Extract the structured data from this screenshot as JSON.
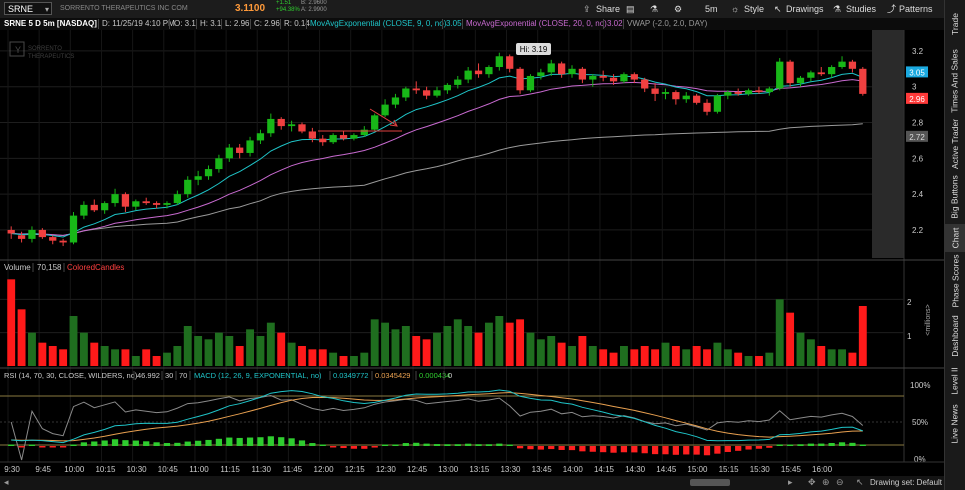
{
  "toolbar": {
    "symbol": "SRNE",
    "company": "SORRENTO THERAPEUTICS INC COM",
    "price": "3.1100",
    "change_abs": "+1.51",
    "change_pct": "+94.38%",
    "bid": "B: 2.9600",
    "ask": "A: 2.9900",
    "share": "Share",
    "timeframe": "5m",
    "style": "Style",
    "drawings": "Drawings",
    "studies": "Studies",
    "patterns": "Patterns"
  },
  "title_row": {
    "label": "SRNE 5 D 5m [NASDAQ]",
    "date": "D: 11/25/19 4:10 PM",
    "open": "O: 3.1",
    "high": "H: 3.1",
    "low": "L: 2.96",
    "close": "C: 2.96",
    "range": "R: 0.14",
    "ema9": "MovAvgExponential (CLOSE, 9, 0, no)",
    "ema9_val": "3.05",
    "ema20": "MovAvgExponential (CLOSE, 20, 0, no)",
    "ema20_val": "3.02",
    "vwap": "VWAP (-2.0, 2.0, DAY)"
  },
  "watermark": [
    "SORRENTO",
    "THERAPEUTICS"
  ],
  "price_axis": {
    "ticks": [
      "3.2",
      "3",
      "2.8",
      "2.6",
      "2.4",
      "2.2"
    ],
    "labels": [
      {
        "text": "3.05",
        "color": "#1aa9e0"
      },
      {
        "text": "2.96",
        "color": "#ff3a3a"
      },
      {
        "text": "2.72",
        "color": "#555555"
      }
    ]
  },
  "hi_label": "Hi: 3.19",
  "volume_pane": {
    "label": "Volume",
    "value": "70,158",
    "study": "ColoredCandles",
    "ticks": [
      "2",
      "1"
    ],
    "unit": "<millions>"
  },
  "indicator_pane": {
    "rsi": "RSI (14, 70, 30, CLOSE, WILDERS, no)",
    "rsi_val": "46.992",
    "ob": "30",
    "os": "70",
    "macd": "MACD (12, 26, 9, EXPONENTIAL, no)",
    "macd_val": "0.0349772",
    "signal_val": "0.0345429",
    "hist_val": "0.000434",
    "zero": "0",
    "ticks": [
      "100%",
      "50%",
      "0%"
    ]
  },
  "time_axis": [
    "9:30",
    "9:45",
    "10:00",
    "10:15",
    "10:30",
    "10:45",
    "11:00",
    "11:15",
    "11:30",
    "11:45",
    "12:00",
    "12:15",
    "12:30",
    "12:45",
    "13:00",
    "13:15",
    "13:30",
    "13:45",
    "14:00",
    "14:15",
    "14:30",
    "14:45",
    "15:00",
    "15:15",
    "15:30",
    "15:45",
    "16:00"
  ],
  "drawing_set": "Drawing set: Default",
  "right_rail": [
    "Trade",
    "Times And Sales",
    "Active Trader",
    "Big Buttons",
    "Chart",
    "Phase Scores",
    "Dashboard",
    "Level II",
    "Live News"
  ],
  "colors": {
    "up": "#18b718",
    "down": "#f04040",
    "ema9": "#1fc4c8",
    "ema20": "#c86ad0",
    "vwap": "#9a9a9a"
  },
  "chart_data": {
    "type": "candlestick",
    "price_range": [
      2.06,
      3.3
    ],
    "candles": [
      [
        2.2,
        2.22,
        2.15,
        2.18
      ],
      [
        2.17,
        2.19,
        2.13,
        2.15
      ],
      [
        2.15,
        2.22,
        2.13,
        2.2
      ],
      [
        2.2,
        2.21,
        2.15,
        2.16
      ],
      [
        2.16,
        2.17,
        2.12,
        2.14
      ],
      [
        2.14,
        2.15,
        2.11,
        2.13
      ],
      [
        2.13,
        2.3,
        2.12,
        2.28
      ],
      [
        2.28,
        2.36,
        2.26,
        2.34
      ],
      [
        2.34,
        2.37,
        2.3,
        2.31
      ],
      [
        2.31,
        2.36,
        2.29,
        2.35
      ],
      [
        2.35,
        2.43,
        2.33,
        2.4
      ],
      [
        2.4,
        2.41,
        2.3,
        2.33
      ],
      [
        2.33,
        2.37,
        2.31,
        2.36
      ],
      [
        2.36,
        2.38,
        2.34,
        2.35
      ],
      [
        2.35,
        2.36,
        2.32,
        2.34
      ],
      [
        2.34,
        2.36,
        2.32,
        2.35
      ],
      [
        2.35,
        2.42,
        2.34,
        2.4
      ],
      [
        2.4,
        2.5,
        2.38,
        2.48
      ],
      [
        2.48,
        2.53,
        2.45,
        2.5
      ],
      [
        2.5,
        2.56,
        2.48,
        2.54
      ],
      [
        2.54,
        2.62,
        2.52,
        2.6
      ],
      [
        2.6,
        2.68,
        2.58,
        2.66
      ],
      [
        2.66,
        2.68,
        2.6,
        2.63
      ],
      [
        2.63,
        2.72,
        2.61,
        2.7
      ],
      [
        2.7,
        2.76,
        2.68,
        2.74
      ],
      [
        2.74,
        2.85,
        2.72,
        2.82
      ],
      [
        2.82,
        2.83,
        2.76,
        2.78
      ],
      [
        2.78,
        2.81,
        2.75,
        2.79
      ],
      [
        2.79,
        2.8,
        2.74,
        2.75
      ],
      [
        2.75,
        2.77,
        2.69,
        2.71
      ],
      [
        2.71,
        2.73,
        2.67,
        2.69
      ],
      [
        2.69,
        2.74,
        2.68,
        2.73
      ],
      [
        2.73,
        2.75,
        2.7,
        2.71
      ],
      [
        2.71,
        2.74,
        2.7,
        2.73
      ],
      [
        2.73,
        2.78,
        2.72,
        2.76
      ],
      [
        2.76,
        2.85,
        2.75,
        2.84
      ],
      [
        2.84,
        2.93,
        2.83,
        2.9
      ],
      [
        2.9,
        2.96,
        2.88,
        2.94
      ],
      [
        2.94,
        3.0,
        2.92,
        2.99
      ],
      [
        2.99,
        3.03,
        2.96,
        2.98
      ],
      [
        2.98,
        3.0,
        2.93,
        2.95
      ],
      [
        2.95,
        3.0,
        2.94,
        2.98
      ],
      [
        2.98,
        3.02,
        2.96,
        3.01
      ],
      [
        3.01,
        3.06,
        2.99,
        3.04
      ],
      [
        3.04,
        3.11,
        3.02,
        3.09
      ],
      [
        3.09,
        3.13,
        3.05,
        3.07
      ],
      [
        3.07,
        3.12,
        3.05,
        3.11
      ],
      [
        3.11,
        3.19,
        3.09,
        3.17
      ],
      [
        3.17,
        3.18,
        3.08,
        3.1
      ],
      [
        3.1,
        3.11,
        2.96,
        2.98
      ],
      [
        2.98,
        3.07,
        2.97,
        3.06
      ],
      [
        3.06,
        3.1,
        3.04,
        3.08
      ],
      [
        3.08,
        3.15,
        3.06,
        3.13
      ],
      [
        3.13,
        3.14,
        3.05,
        3.07
      ],
      [
        3.07,
        3.12,
        3.05,
        3.1
      ],
      [
        3.1,
        3.11,
        3.02,
        3.04
      ],
      [
        3.04,
        3.07,
        3.0,
        3.06
      ],
      [
        3.06,
        3.09,
        3.03,
        3.05
      ],
      [
        3.05,
        3.07,
        3.01,
        3.03
      ],
      [
        3.03,
        3.08,
        3.02,
        3.07
      ],
      [
        3.07,
        3.08,
        3.02,
        3.04
      ],
      [
        3.04,
        3.05,
        2.97,
        2.99
      ],
      [
        2.99,
        3.02,
        2.92,
        2.96
      ],
      [
        2.96,
        2.99,
        2.93,
        2.97
      ],
      [
        2.97,
        2.98,
        2.9,
        2.93
      ],
      [
        2.93,
        2.97,
        2.91,
        2.95
      ],
      [
        2.95,
        2.96,
        2.9,
        2.91
      ],
      [
        2.91,
        2.93,
        2.84,
        2.86
      ],
      [
        2.86,
        2.96,
        2.85,
        2.95
      ],
      [
        2.95,
        2.98,
        2.93,
        2.97
      ],
      [
        2.97,
        2.99,
        2.95,
        2.96
      ],
      [
        2.96,
        2.99,
        2.95,
        2.98
      ],
      [
        2.98,
        3.0,
        2.96,
        2.97
      ],
      [
        2.97,
        3.0,
        2.95,
        2.99
      ],
      [
        2.99,
        3.16,
        2.98,
        3.14
      ],
      [
        3.14,
        3.15,
        3.0,
        3.02
      ],
      [
        3.02,
        3.06,
        3.0,
        3.05
      ],
      [
        3.05,
        3.09,
        3.03,
        3.08
      ],
      [
        3.08,
        3.11,
        3.06,
        3.07
      ],
      [
        3.07,
        3.12,
        3.05,
        3.11
      ],
      [
        3.11,
        3.17,
        3.1,
        3.14
      ],
      [
        3.14,
        3.15,
        3.08,
        3.1
      ],
      [
        3.1,
        3.11,
        2.95,
        2.96
      ]
    ],
    "volume_range": [
      0,
      2.7
    ],
    "volume": [
      2.6,
      1.7,
      1.0,
      0.7,
      0.6,
      0.5,
      1.5,
      1.0,
      0.7,
      0.6,
      0.5,
      0.5,
      0.3,
      0.5,
      0.3,
      0.4,
      0.6,
      1.2,
      0.9,
      0.8,
      1.0,
      0.9,
      0.6,
      1.1,
      0.9,
      1.3,
      1.0,
      0.7,
      0.6,
      0.5,
      0.5,
      0.4,
      0.3,
      0.3,
      0.4,
      1.4,
      1.3,
      1.1,
      1.2,
      0.9,
      0.8,
      1.0,
      1.2,
      1.4,
      1.2,
      1.0,
      1.3,
      1.5,
      1.3,
      1.4,
      1.0,
      0.8,
      0.9,
      0.7,
      0.6,
      0.9,
      0.6,
      0.5,
      0.4,
      0.6,
      0.5,
      0.6,
      0.5,
      0.7,
      0.6,
      0.5,
      0.6,
      0.5,
      0.7,
      0.5,
      0.4,
      0.3,
      0.3,
      0.4,
      2.0,
      1.6,
      1.0,
      0.8,
      0.6,
      0.5,
      0.5,
      0.4,
      1.8
    ]
  }
}
